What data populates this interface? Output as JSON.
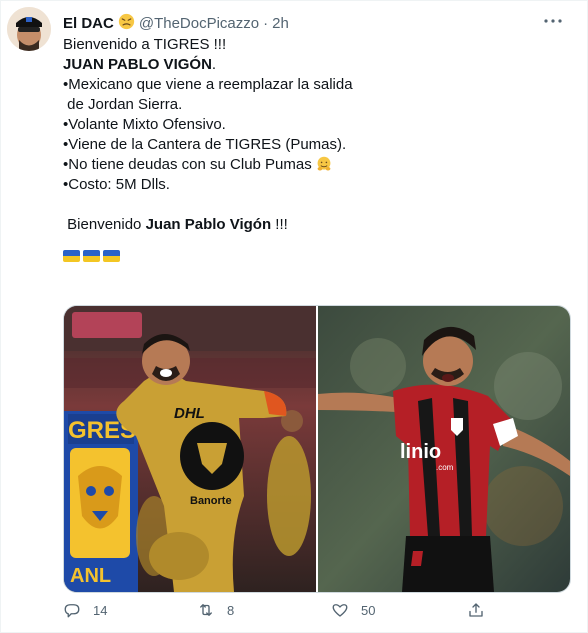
{
  "tweet": {
    "display_name": "El DAC",
    "name_emoji": "persevering-face-emoji",
    "handle": "@TheDocPicazzo",
    "separator": "·",
    "time": "2h",
    "lines": [
      "Bienvenido a TIGRES !!!",
      "",
      "•Mexicano que viene a reemplazar la salida",
      " de Jordan Sierra.",
      "•Volante Mixto Ofensivo.",
      "•Viene de la Cantera de TIGRES (Pumas).",
      "•Costo: 5M Dlls."
    ],
    "headline_bold": "JUAN PABLO VIGÓN",
    "headline_rest": ".",
    "debt_line": "•No tiene deudas con su Club Pumas ",
    "debt_emoji": "hugging-face-emoji",
    "welcome_prefix": " Bienvenido ",
    "welcome_bold": "Juan Pablo Vigón",
    "welcome_suffix": " !!!",
    "flag_icons": [
      "ukraine-flag-icon",
      "ukraine-flag-icon",
      "ukraine-flag-icon"
    ]
  },
  "media": {
    "left_photo": {
      "jersey_text": "DHL",
      "sponsor_text": "Banorte",
      "badge_text": "GRES",
      "badge_bottom": "ANL"
    },
    "right_photo": {
      "jersey_text": "linio",
      "jersey_sub": ".com"
    }
  },
  "actions": {
    "reply_count": "14",
    "retweet_count": "8",
    "like_count": "50"
  },
  "colors": {
    "link_gray": "#536471",
    "border": "#cfd9de",
    "flag_blue": "#2a62c8",
    "flag_yellow": "#f3c623"
  }
}
